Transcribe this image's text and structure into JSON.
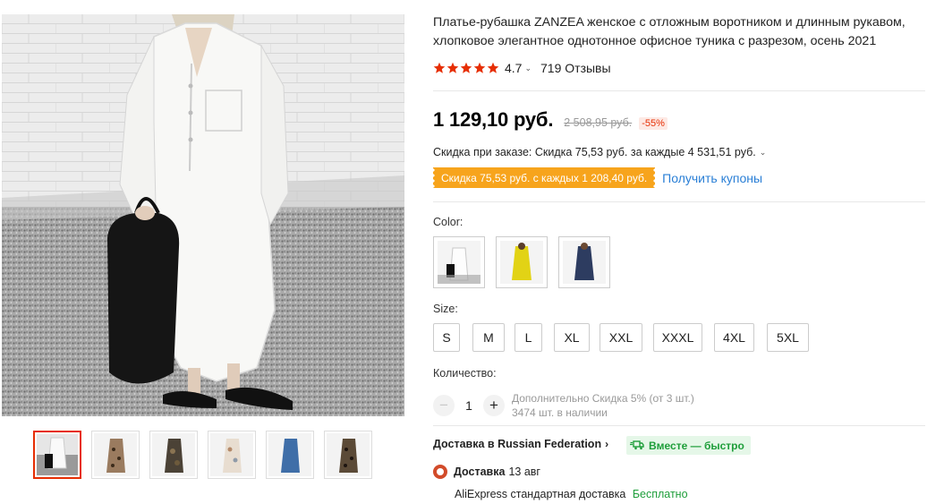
{
  "product": {
    "title": "Платье-рубашка ZANZEA женское с отложным воротником и длинным рукавом, хлопковое элегантное однотонное офисное туника с разрезом, осень 2021",
    "rating": "4.7",
    "reviews": "719 Отзывы",
    "star_color": "#e62e04"
  },
  "price": {
    "current": "1 129,10 руб.",
    "original": "2 508,95 руб.",
    "discount_percent": "-55%"
  },
  "order_discount": "Скидка при заказе: Скидка 75,53 руб. за каждые 4 531,51 руб.",
  "coupon": {
    "tag": "Скидка 75,53 руб. с каждых 1 208,40 руб.",
    "link": "Получить купоны",
    "tag_color": "#f7a41c"
  },
  "color": {
    "label": "Color:",
    "options": [
      "white",
      "yellow",
      "navy"
    ]
  },
  "size": {
    "label": "Size:",
    "options": [
      "S",
      "M",
      "L",
      "XL",
      "XXL",
      "XXXL",
      "4XL",
      "5XL"
    ]
  },
  "quantity": {
    "label": "Количество:",
    "value": "1",
    "decrease": "−",
    "increase": "+",
    "extra_discount": "Дополнительно Скидка 5% (от 3 шт.)",
    "stock": "3474 шт. в наличии"
  },
  "shipping": {
    "destination": "Доставка в Russian Federation",
    "chevron": "›",
    "fast_badge": "Вместе — быстро",
    "method_label": "Доставка",
    "date": "13 авг",
    "carrier": "AliExpress стандартная доставка",
    "cost": "Бесплатно"
  },
  "thumbnails": [
    "white",
    "leopard-beige",
    "camo-dark",
    "floral-light",
    "denim-blue",
    "leopard-dark"
  ],
  "icons": {
    "star": "star-icon",
    "chevron_down": "chevron-down-icon",
    "truck": "truck-icon",
    "radio": "radio-selected-icon"
  }
}
